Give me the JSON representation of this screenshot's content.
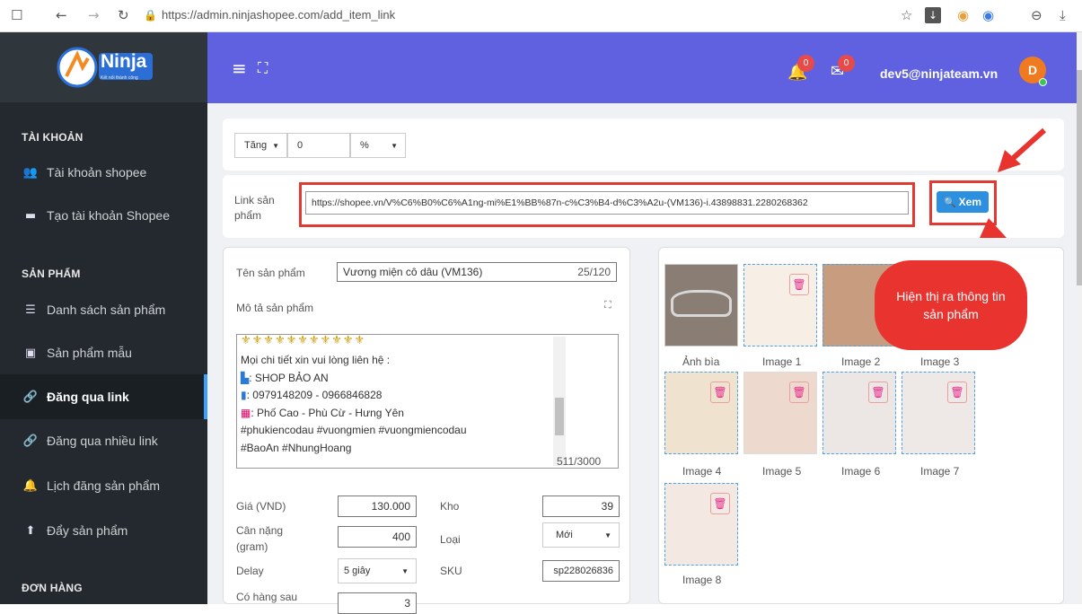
{
  "browser": {
    "url": "https://admin.ninjashopee.com/add_item_link"
  },
  "brand": {
    "logo_text": "Ninja",
    "logo_sub": "Kết nối thành công"
  },
  "header": {
    "user_email": "dev5@ninjateam.vn",
    "avatar_letter": "D",
    "bell_count": "0",
    "mail_count": "0"
  },
  "sidebar": {
    "sections": [
      {
        "title": "TÀI KHOẢN",
        "items": [
          {
            "label": "Tài khoản shopee",
            "icon": "users-icon"
          },
          {
            "label": "Tạo tài khoản Shopee",
            "icon": "store-icon"
          }
        ]
      },
      {
        "title": "SẢN PHẨM",
        "items": [
          {
            "label": "Danh sách sản phẩm",
            "icon": "list-icon"
          },
          {
            "label": "Sản phẩm mẫu",
            "icon": "file-icon"
          },
          {
            "label": "Đăng qua link",
            "icon": "link-icon"
          },
          {
            "label": "Đăng qua nhiều link",
            "icon": "link-icon"
          },
          {
            "label": "Lịch đăng sản phẩm",
            "icon": "bell-icon"
          },
          {
            "label": "Đẩy sản phẩm",
            "icon": "upload-icon"
          }
        ]
      },
      {
        "title": "ĐƠN HÀNG",
        "items": []
      }
    ]
  },
  "price_adjust": {
    "mode": "Tăng",
    "amount": "0",
    "unit": "%"
  },
  "link_row": {
    "label": "Link sản phẩm",
    "value": "https://shopee.vn/V%C6%B0%C6%A1ng-mi%E1%BB%87n-c%C3%B4-d%C3%A2u-(VM136)-i.43898831.2280268362",
    "button": "Xem"
  },
  "callout": {
    "text": "Hiện thị ra thông tin sản phẩm"
  },
  "product": {
    "name_label": "Tên sản phẩm",
    "name_value": "Vương miện cô dâu (VM136)",
    "name_count": "25/120",
    "desc_label": "Mô tả sản phẩm",
    "desc_lines": [
      "Mọi chi tiết xin vui lòng liên hệ :",
      ": SHOP BẢO AN",
      ": 0979148209 - 0966846828",
      ": Phố Cao - Phù Cừ - Hưng Yên",
      "#phukiencodau #vuongmien #vuongmiencodau",
      "#BaoAn #NhungHoang"
    ],
    "desc_count": "511/3000",
    "price_label": "Giá (VND)",
    "price_value": "130.000",
    "stock_label": "Kho",
    "stock_value": "39",
    "weight_label": "Cân nặng (gram)",
    "weight_value": "400",
    "type_label": "Loại",
    "type_value": "Mới",
    "delay_label": "Delay",
    "delay_value": "5 giây",
    "sku_label": "SKU",
    "sku_value": "sp228026836",
    "after_label": "Có hàng sau",
    "after_value": "3"
  },
  "images": {
    "captions": [
      "Ảnh bìa",
      "Image 1",
      "Image 2",
      "Image 3",
      "Image 4",
      "Image 5",
      "Image 6",
      "Image 7",
      "Image 8"
    ]
  },
  "colors": {
    "topbar": "#5f61e0",
    "sidebar": "#23292f",
    "accent_red": "#e8332f",
    "button_blue": "#2d8fe0"
  }
}
